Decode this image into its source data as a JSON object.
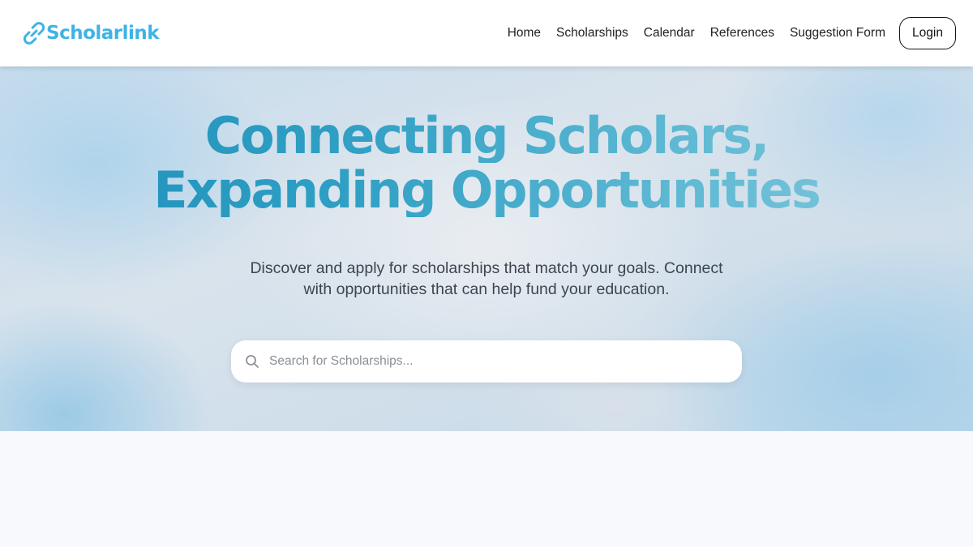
{
  "brand": {
    "name": "Scholarlink",
    "color": "#3fb3e6"
  },
  "nav": {
    "links": [
      {
        "label": "Home"
      },
      {
        "label": "Scholarships"
      },
      {
        "label": "Calendar"
      },
      {
        "label": "References"
      },
      {
        "label": "Suggestion Form"
      }
    ],
    "login_label": "Login"
  },
  "hero": {
    "title_line1": "Connecting Scholars,",
    "title_line2": "Expanding Opportunities",
    "subtitle": "Discover and apply for scholarships that match your goals. Connect with opportunities that can help fund your education.",
    "title_gradient": [
      "#1e8fb8",
      "#86cbde"
    ]
  },
  "search": {
    "placeholder": "Search for Scholarships...",
    "value": "",
    "icon": "search-icon"
  }
}
